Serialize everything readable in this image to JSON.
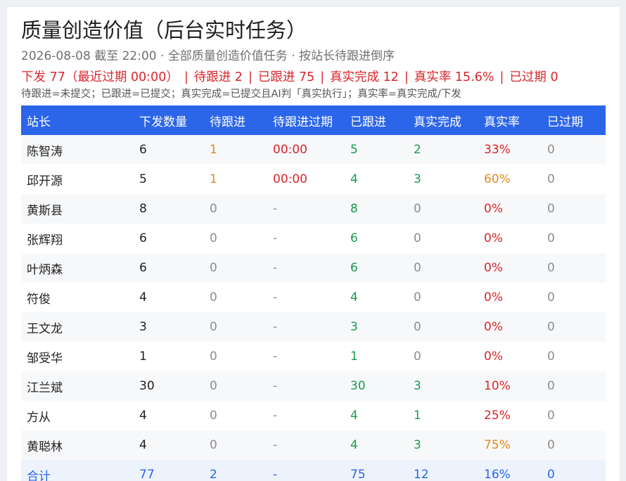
{
  "header": {
    "title": "质量创造价值（后台实时任务）",
    "subtitle": "2026-08-08 截至 22:00 · 全部质量创造价值任务 · 按站长待跟进倒序",
    "summary": [
      "下发 77（最近过期 00:00）",
      "待跟进 2",
      "已跟进 75",
      "真实完成 12",
      "真实率 15.6%",
      "已过期 0"
    ],
    "summary_separator": "|",
    "note": "待跟进=未提交；已跟进=已提交；真实完成=已提交且AI判「真实执行」；真实率=真实完成/下发"
  },
  "table": {
    "columns": [
      "站长",
      "下发数量",
      "待跟进",
      "待跟进过期",
      "已跟进",
      "真实完成",
      "真实率",
      "已过期"
    ],
    "rows": [
      {
        "name": "陈智涛",
        "issued": "6",
        "pending": "1",
        "pending_expire": "00:00",
        "followed": "5",
        "real_done": "2",
        "real_rate": "33%",
        "expired": "0"
      },
      {
        "name": "邱开源",
        "issued": "5",
        "pending": "1",
        "pending_expire": "00:00",
        "followed": "4",
        "real_done": "3",
        "real_rate": "60%",
        "expired": "0"
      },
      {
        "name": "黄斯县",
        "issued": "8",
        "pending": "0",
        "pending_expire": "-",
        "followed": "8",
        "real_done": "0",
        "real_rate": "0%",
        "expired": "0"
      },
      {
        "name": "张辉翔",
        "issued": "6",
        "pending": "0",
        "pending_expire": "-",
        "followed": "6",
        "real_done": "0",
        "real_rate": "0%",
        "expired": "0"
      },
      {
        "name": "叶炳森",
        "issued": "6",
        "pending": "0",
        "pending_expire": "-",
        "followed": "6",
        "real_done": "0",
        "real_rate": "0%",
        "expired": "0"
      },
      {
        "name": "符俊",
        "issued": "4",
        "pending": "0",
        "pending_expire": "-",
        "followed": "4",
        "real_done": "0",
        "real_rate": "0%",
        "expired": "0"
      },
      {
        "name": "王文龙",
        "issued": "3",
        "pending": "0",
        "pending_expire": "-",
        "followed": "3",
        "real_done": "0",
        "real_rate": "0%",
        "expired": "0"
      },
      {
        "name": "邹受华",
        "issued": "1",
        "pending": "0",
        "pending_expire": "-",
        "followed": "1",
        "real_done": "0",
        "real_rate": "0%",
        "expired": "0"
      },
      {
        "name": "江兰斌",
        "issued": "30",
        "pending": "0",
        "pending_expire": "-",
        "followed": "30",
        "real_done": "3",
        "real_rate": "10%",
        "expired": "0"
      },
      {
        "name": "方从",
        "issued": "4",
        "pending": "0",
        "pending_expire": "-",
        "followed": "4",
        "real_done": "1",
        "real_rate": "25%",
        "expired": "0"
      },
      {
        "name": "黄聪林",
        "issued": "4",
        "pending": "0",
        "pending_expire": "-",
        "followed": "4",
        "real_done": "3",
        "real_rate": "75%",
        "expired": "0"
      }
    ],
    "total": {
      "name": "合计",
      "issued": "77",
      "pending": "2",
      "pending_expire": "-",
      "followed": "75",
      "real_done": "12",
      "real_rate": "16%",
      "expired": "0"
    }
  },
  "colors": {
    "header_bg": "#2b65ea",
    "alert_red": "#d8262b",
    "good_green": "#1a9a4d",
    "warn_orange": "#e08a1c",
    "muted_gray": "#8d8d8d",
    "total_blue": "#2b65ea"
  }
}
